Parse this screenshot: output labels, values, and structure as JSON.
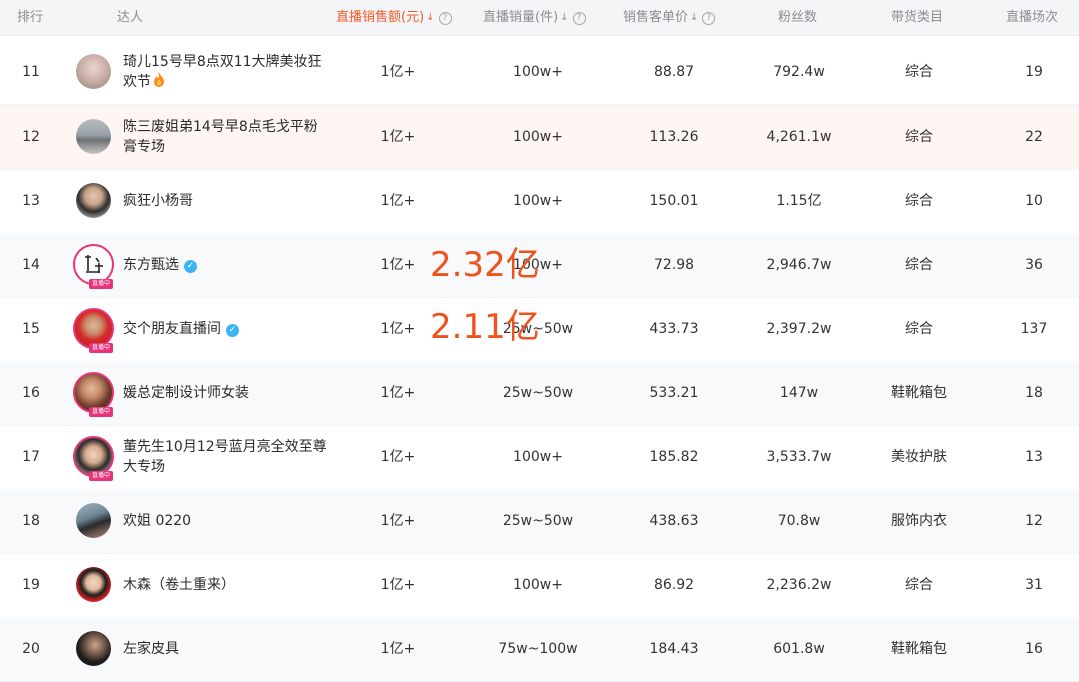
{
  "header": {
    "columns": {
      "rank": "排行",
      "creator": "达人",
      "sales": "直播销售额(元)",
      "volume": "直播销量(件)",
      "price": "销售客单价",
      "fans": "粉丝数",
      "category": "带货类目",
      "shows": "直播场次"
    }
  },
  "live_tag_text": "直播中",
  "rows": [
    {
      "rank": "11",
      "name_l1": "琦儿15号早8点双11大牌美妆狂",
      "name_l2": "欢节",
      "sales": "1亿+",
      "volume": "100w+",
      "price": "88.87",
      "fans": "792.4w",
      "category": "综合",
      "shows": "19"
    },
    {
      "rank": "12",
      "name_l1": "陈三废姐弟14号早8点毛戈平粉",
      "name_l2": "膏专场",
      "sales": "1亿+",
      "volume": "100w+",
      "price": "113.26",
      "fans": "4,261.1w",
      "category": "综合",
      "shows": "22"
    },
    {
      "rank": "13",
      "name": "疯狂小杨哥",
      "sales": "1亿+",
      "volume": "100w+",
      "price": "150.01",
      "fans": "1.15亿",
      "category": "综合",
      "shows": "10"
    },
    {
      "rank": "14",
      "name": "东方甄选",
      "sales": "1亿+",
      "volume": "100w+",
      "price": "72.98",
      "fans": "2,946.7w",
      "category": "综合",
      "shows": "36"
    },
    {
      "rank": "15",
      "name": "交个朋友直播间",
      "sales": "1亿+",
      "volume": "25w~50w",
      "price": "433.73",
      "fans": "2,397.2w",
      "category": "综合",
      "shows": "137"
    },
    {
      "rank": "16",
      "name": "媛总定制设计师女装",
      "sales": "1亿+",
      "volume": "25w~50w",
      "price": "533.21",
      "fans": "147w",
      "category": "鞋靴箱包",
      "shows": "18"
    },
    {
      "rank": "17",
      "name_l1": "董先生10月12号蓝月亮全效至尊",
      "name_l2": "大专场",
      "sales": "1亿+",
      "volume": "100w+",
      "price": "185.82",
      "fans": "3,533.7w",
      "category": "美妆护肤",
      "shows": "13"
    },
    {
      "rank": "18",
      "name": "欢姐 0220",
      "sales": "1亿+",
      "volume": "25w~50w",
      "price": "438.63",
      "fans": "70.8w",
      "category": "服饰内衣",
      "shows": "12"
    },
    {
      "rank": "19",
      "name": "木森（卷土重来）",
      "sales": "1亿+",
      "volume": "100w+",
      "price": "86.92",
      "fans": "2,236.2w",
      "category": "综合",
      "shows": "31"
    },
    {
      "rank": "20",
      "name": "左家皮具",
      "sales": "1亿+",
      "volume": "75w~100w",
      "price": "184.43",
      "fans": "601.8w",
      "category": "鞋靴箱包",
      "shows": "16"
    }
  ],
  "annotations": {
    "row14": "2.32亿",
    "row15": "2.11亿"
  },
  "colors": {
    "accent": "#f25a2b",
    "annotation": "#f0521e",
    "live_ring": "#e8337a",
    "verified": "#3db4f2"
  }
}
